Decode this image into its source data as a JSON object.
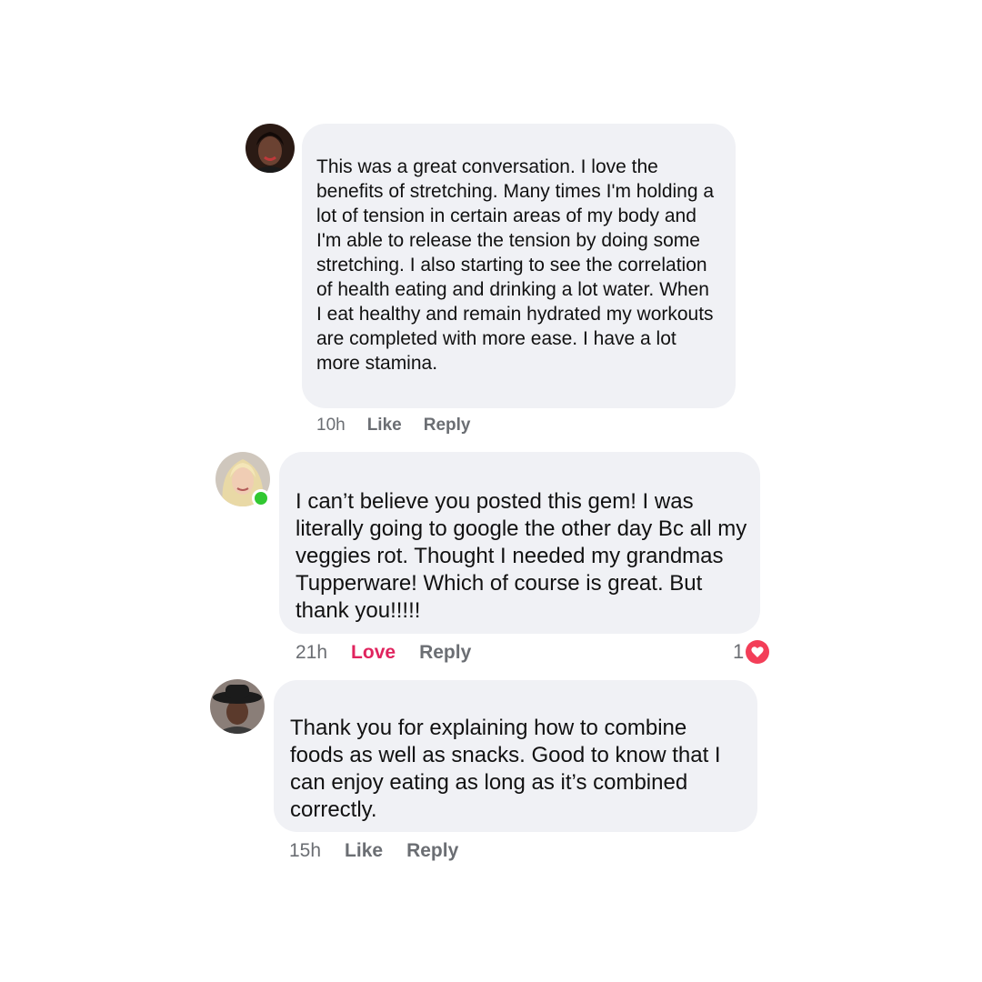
{
  "colors": {
    "bubble_bg": "#f0f1f5",
    "text": "#111111",
    "meta": "#6b6e73",
    "love": "#e0245e",
    "online": "#31c831",
    "heart_badge": "#f33e58"
  },
  "comments": [
    {
      "avatar_icon": "user-avatar-icon",
      "text": "This was a great conversation.  I love the benefits of stretching. Many times I'm holding a lot of tension in certain areas of my body and I'm able to release the tension by doing some stretching. I also starting to see the correlation of health eating and drinking a lot water. When I eat healthy and remain hydrated my workouts are completed with more ease.  I have a lot more stamina.",
      "time": "10h",
      "like_label": "Like",
      "reply_label": "Reply"
    },
    {
      "avatar_icon": "user-avatar-icon",
      "online": true,
      "text": "I can’t believe you posted this gem! I was literally going to google the other day Bc all my veggies rot. Thought I needed my grandmas Tupperware! Which of course is great. But thank you!!!!!",
      "time": "21h",
      "like_label": "Love",
      "reply_label": "Reply",
      "reaction_count": "1",
      "reaction_icon": "heart-icon"
    },
    {
      "avatar_icon": "user-avatar-icon",
      "text": "Thank you for explaining how to combine foods as well as snacks. Good to know that I can enjoy eating as long as it’s combined correctly.",
      "time": "15h",
      "like_label": "Like",
      "reply_label": "Reply"
    }
  ]
}
